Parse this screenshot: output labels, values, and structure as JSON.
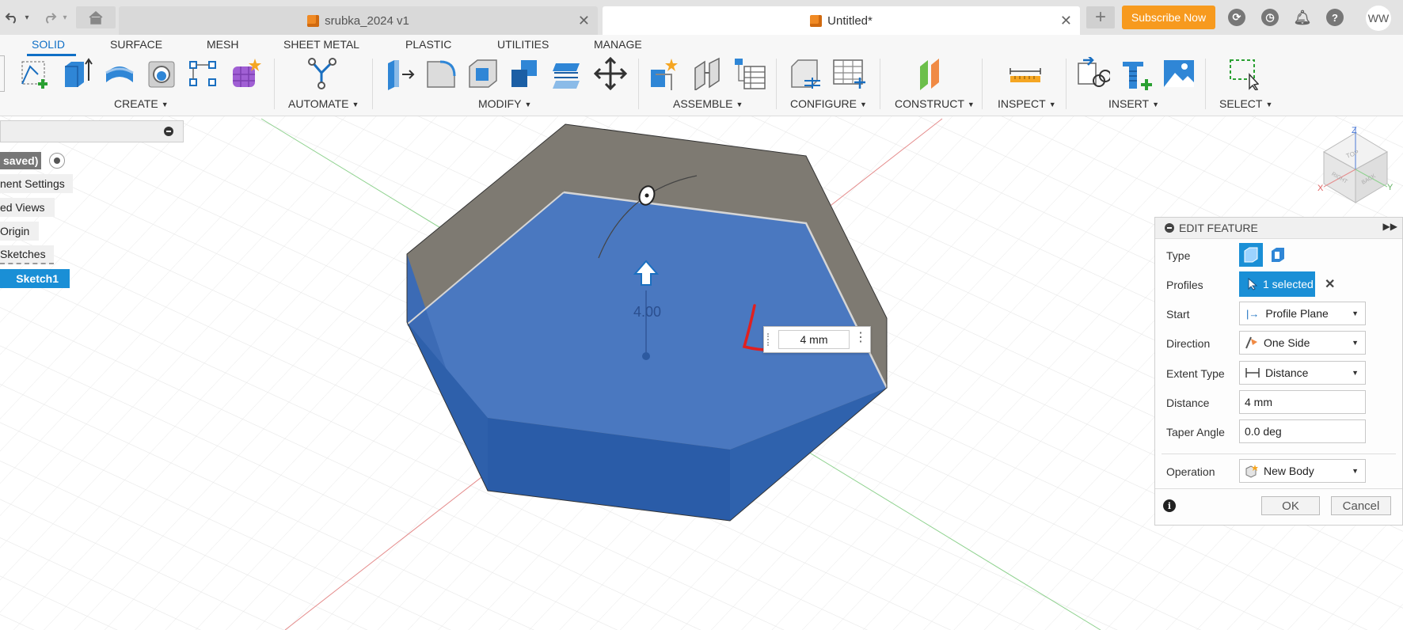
{
  "window": {
    "tabs": [
      {
        "label": "srubka_2024 v1",
        "active": false
      },
      {
        "label": "Untitled*",
        "active": true
      }
    ],
    "subscribe_label": "Subscribe Now",
    "user_initials": "WW"
  },
  "ribbon": {
    "tabs": [
      "SOLID",
      "SURFACE",
      "MESH",
      "SHEET METAL",
      "PLASTIC",
      "UTILITIES",
      "MANAGE"
    ],
    "active_tab": "SOLID",
    "groups": [
      "CREATE",
      "AUTOMATE",
      "MODIFY",
      "ASSEMBLE",
      "CONFIGURE",
      "CONSTRUCT",
      "INSPECT",
      "INSERT",
      "SELECT"
    ]
  },
  "browser": {
    "items": [
      "saved)",
      "nent Settings",
      "ed Views",
      "Origin",
      "Sketches",
      "Sketch1"
    ]
  },
  "viewport": {
    "dimension_label": "4.00",
    "distance_input": "4 mm",
    "viewcube_axes": {
      "z": "Z",
      "x": "X",
      "y": "Y"
    },
    "viewcube_faces": {
      "top": "TOP",
      "right": "RIGHT",
      "back": "BACK"
    }
  },
  "edit_feature": {
    "title": "EDIT FEATURE",
    "type_label": "Type",
    "profiles_label": "Profiles",
    "profiles_value": "1 selected",
    "start_label": "Start",
    "start_value": "Profile Plane",
    "direction_label": "Direction",
    "direction_value": "One Side",
    "extent_label": "Extent Type",
    "extent_value": "Distance",
    "distance_label": "Distance",
    "distance_value": "4 mm",
    "taper_label": "Taper Angle",
    "taper_value": "0.0 deg",
    "operation_label": "Operation",
    "operation_value": "New Body",
    "ok_label": "OK",
    "cancel_label": "Cancel"
  },
  "colors": {
    "accent": "#0f6fc6",
    "subscribe": "#f79a1e",
    "selection": "#1a8fd6",
    "body_blue": "#3d6fb8",
    "body_gray": "#7e7a72"
  }
}
